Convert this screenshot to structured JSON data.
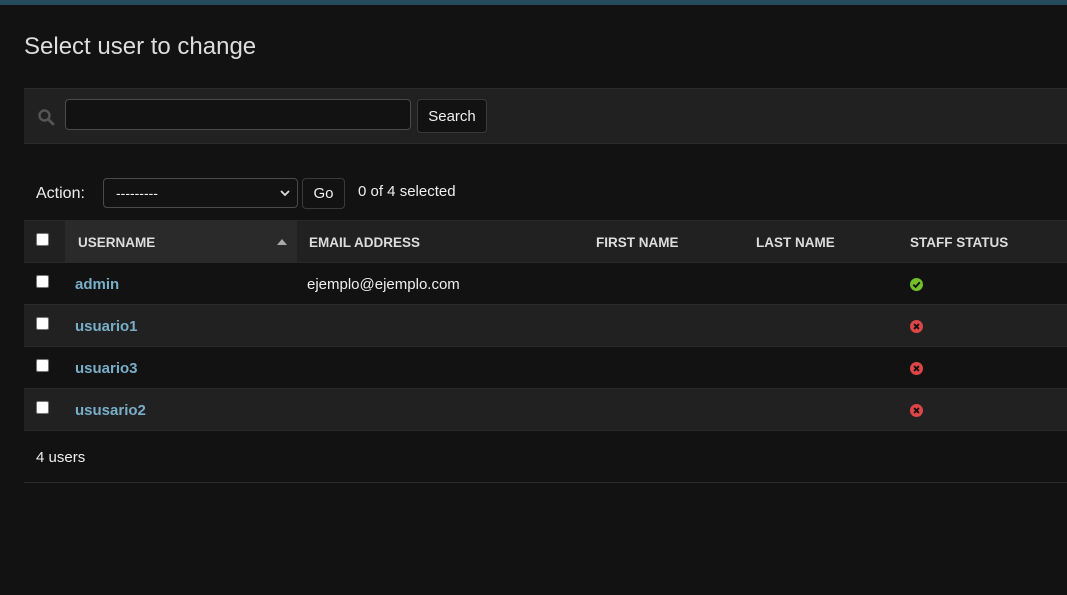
{
  "page": {
    "title": "Select user to change"
  },
  "search": {
    "value": "",
    "placeholder": "",
    "button_label": "Search"
  },
  "actions": {
    "label": "Action:",
    "selected_option": "---------",
    "go_label": "Go",
    "selection_count": "0 of 4 selected"
  },
  "table": {
    "columns": [
      "Username",
      "Email address",
      "First name",
      "Last name",
      "Staff status"
    ],
    "sorted_column": "Username",
    "sort_direction": "ascending",
    "rows": [
      {
        "username": "admin",
        "email": "ejemplo@ejemplo.com",
        "first_name": "",
        "last_name": "",
        "staff_status": true
      },
      {
        "username": "usuario1",
        "email": "",
        "first_name": "",
        "last_name": "",
        "staff_status": false
      },
      {
        "username": "usuario3",
        "email": "",
        "first_name": "",
        "last_name": "",
        "staff_status": false
      },
      {
        "username": "ususario2",
        "email": "",
        "first_name": "",
        "last_name": "",
        "staff_status": false
      }
    ]
  },
  "paginator": {
    "count_text": "4 users"
  },
  "colors": {
    "header_bar": "#264b5d",
    "link": "#79aec8",
    "yes_icon": "#70bf2b",
    "no_icon": "#dd4646",
    "background": "#121212",
    "row_alt": "#212121"
  },
  "icons": {
    "search": "search-icon",
    "yes": "check-circle-icon",
    "no": "x-circle-icon",
    "sort": "sort-ascending-icon",
    "select": "chevron-down-icon"
  }
}
